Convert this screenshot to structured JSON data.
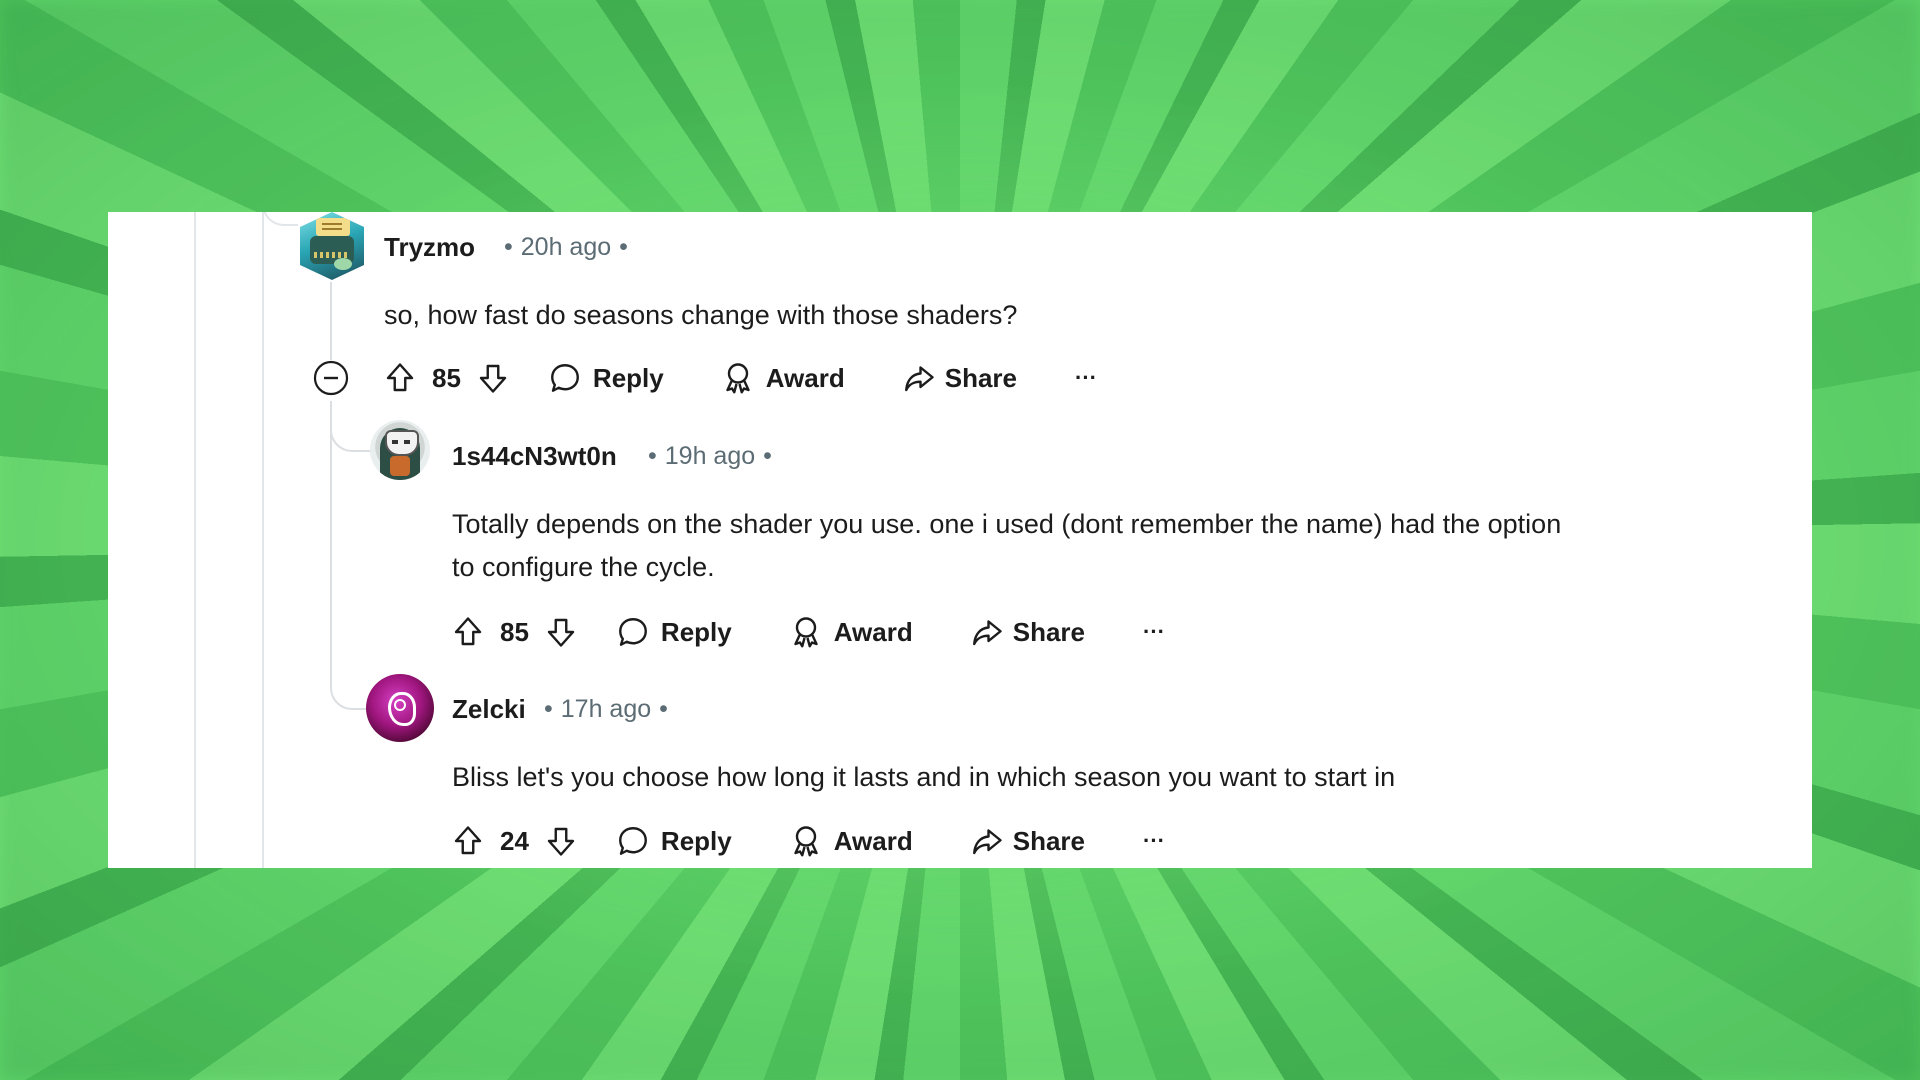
{
  "comments": [
    {
      "username": "Tryzmo",
      "time": "20h ago",
      "body_lines": [
        "so, how fast do seasons change with those shaders?"
      ],
      "score": "85",
      "avatar_icon": "typewriter-avatar"
    },
    {
      "username": "1s44cN3wt0n",
      "time": "19h ago",
      "body_lines": [
        "Totally depends on the shader you use. one i used (dont remember the name) had the option",
        "to configure the cycle."
      ],
      "score": "85",
      "avatar_icon": "masked-hooded-avatar"
    },
    {
      "username": "Zelcki",
      "time": "17h ago",
      "body_lines": [
        "Bliss let's you choose how long it lasts and in which season you want to start in"
      ],
      "score": "24",
      "avatar_icon": "purple-swirl-avatar"
    }
  ],
  "actions": {
    "reply": "Reply",
    "award": "Award",
    "share": "Share",
    "more": "···"
  },
  "separator": "•",
  "colors": {
    "background": "#5ccc66",
    "card": "#ffffff",
    "text": "#1c1c1c",
    "meta": "#5c6c74",
    "thread_line": "#dcdfe2"
  }
}
